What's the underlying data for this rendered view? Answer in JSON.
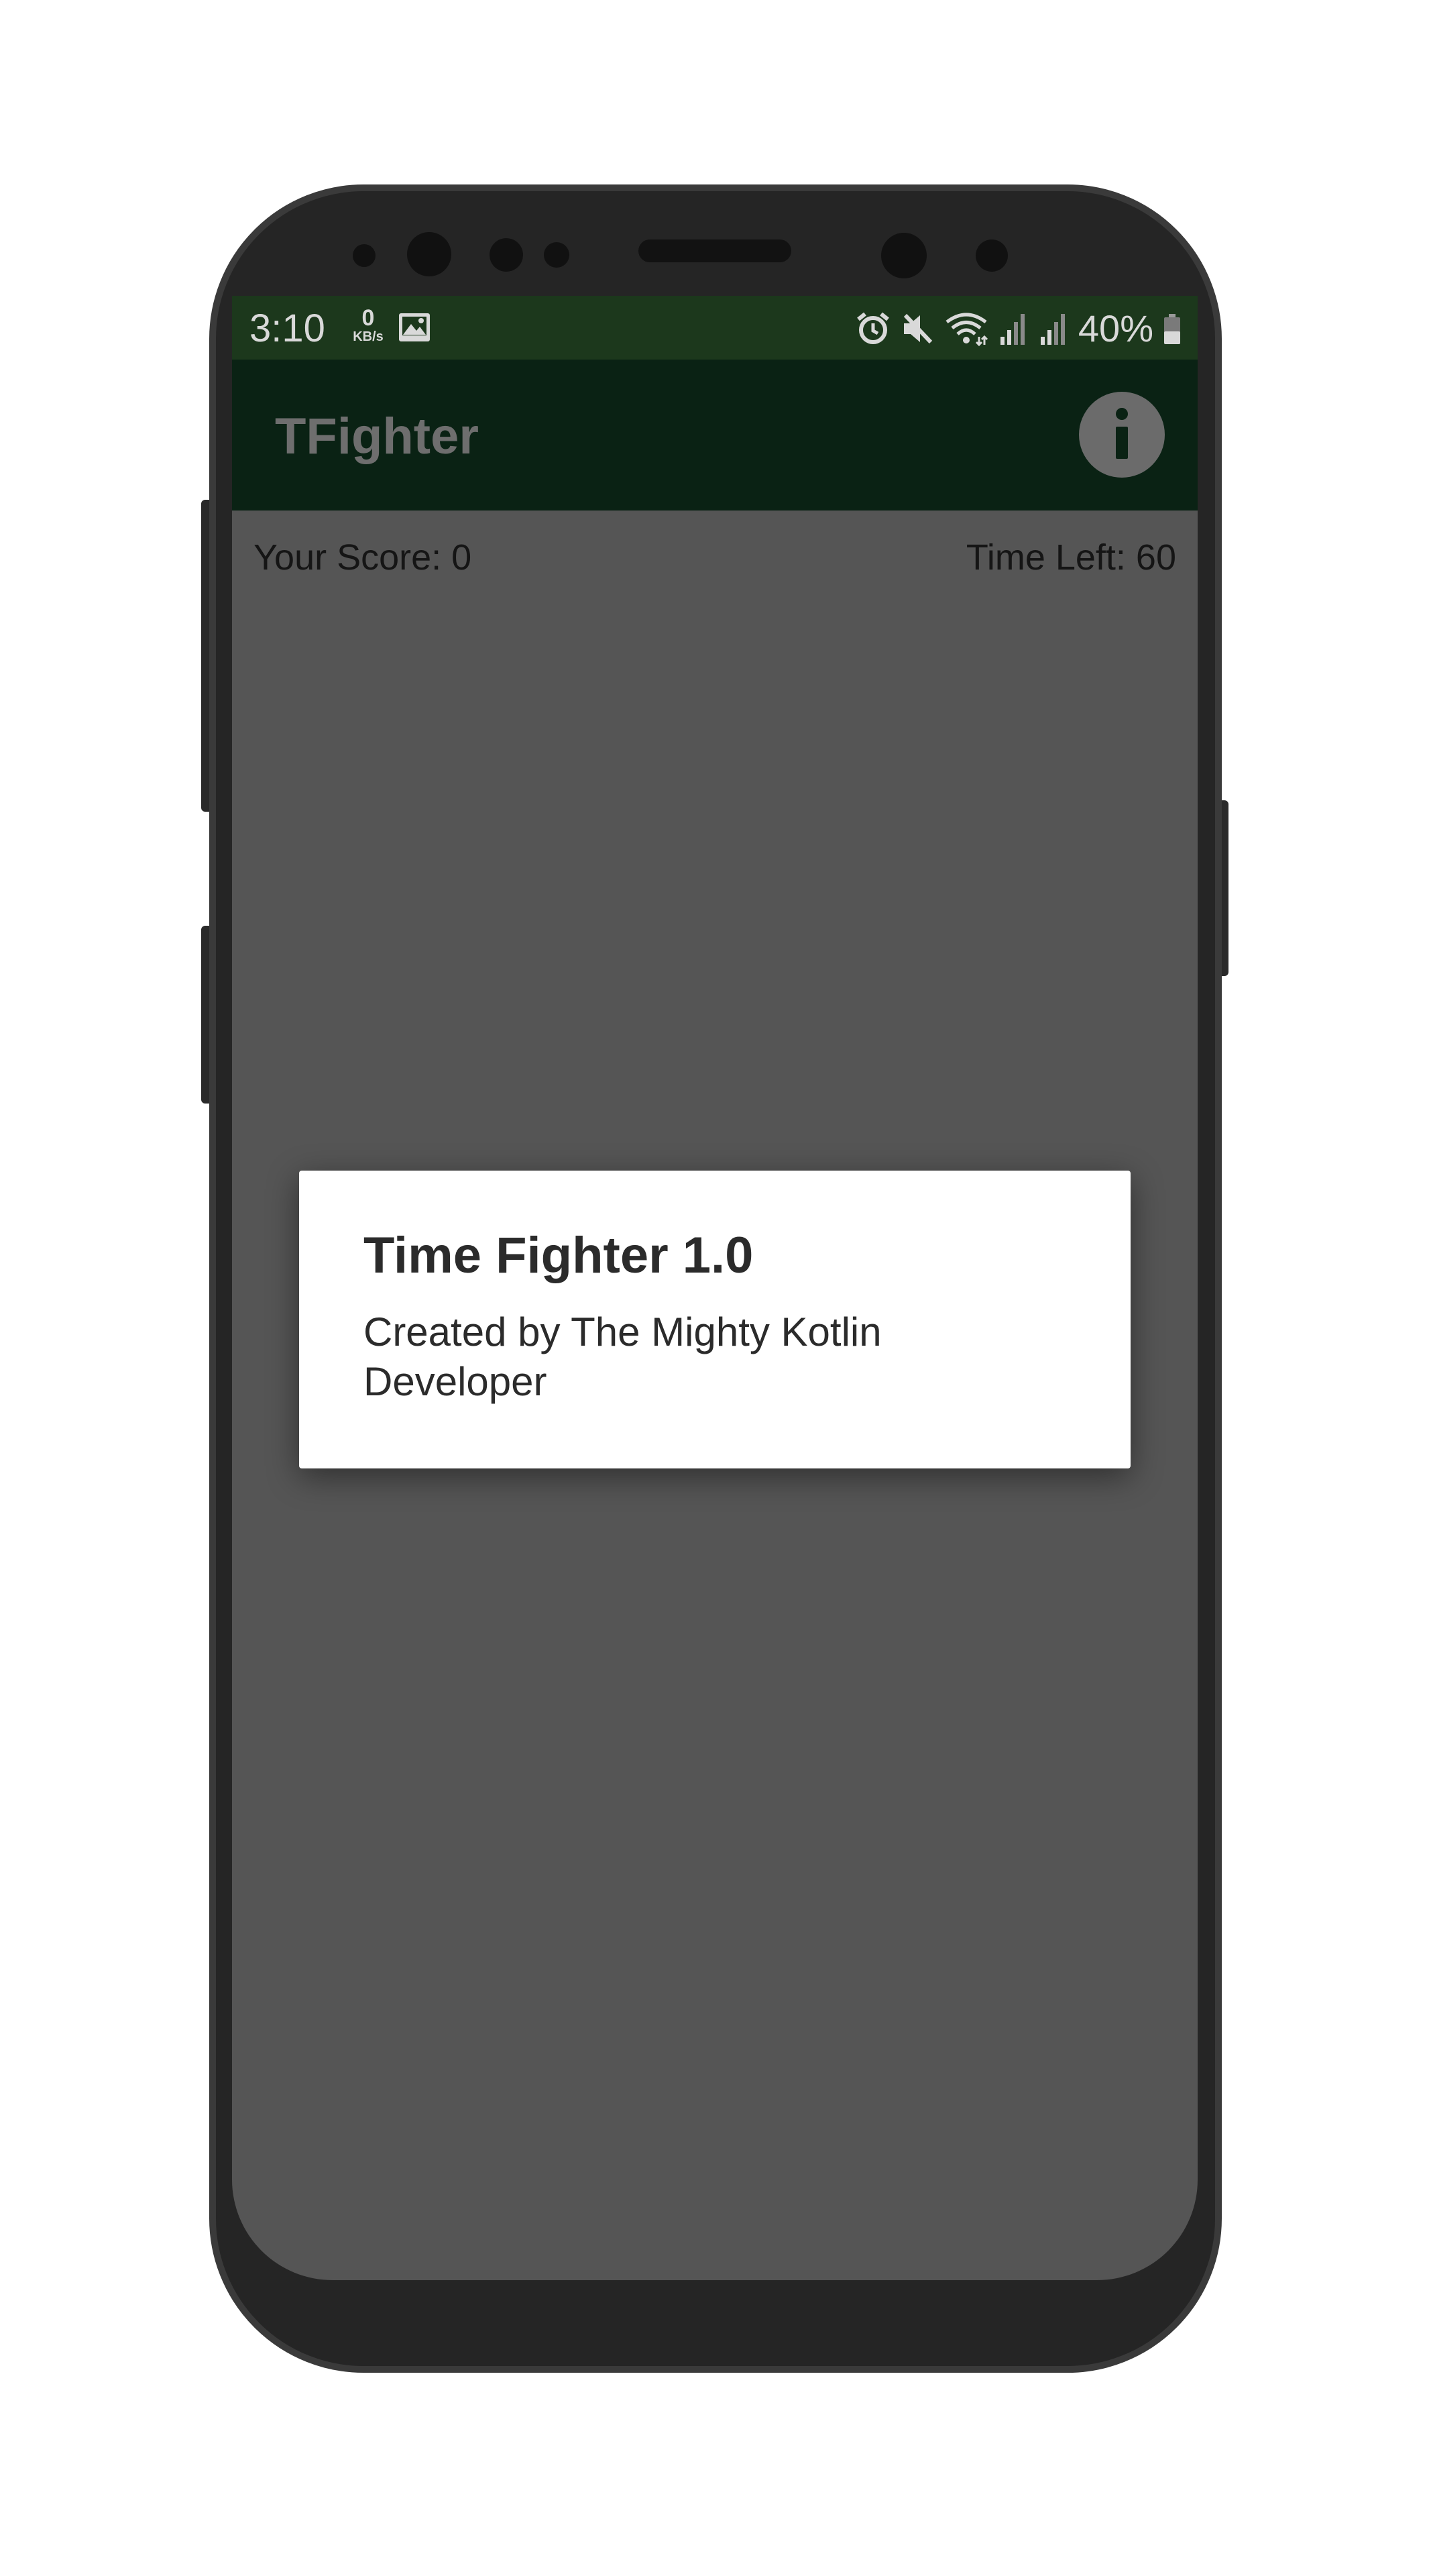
{
  "status_bar": {
    "time": "3:10",
    "net_speed_value": "0",
    "net_speed_unit": "KB/s",
    "battery_percent": "40%",
    "icons": [
      "image-icon",
      "alarm-icon",
      "mute-icon",
      "wifi-icon",
      "signal-icon",
      "signal-icon",
      "battery-icon"
    ]
  },
  "app_bar": {
    "title": "TFighter",
    "info_icon": "info-icon"
  },
  "game": {
    "score_label": "Your Score: 0",
    "time_left_label": "Time Left: 60"
  },
  "dialog": {
    "title": "Time Fighter 1.0",
    "message": "Created by The Mighty Kotlin Developer"
  },
  "colors": {
    "status_bar": "#1c381c",
    "app_bar": "#0a2214",
    "scrim_background": "#555555",
    "dialog_background": "#ffffff"
  }
}
